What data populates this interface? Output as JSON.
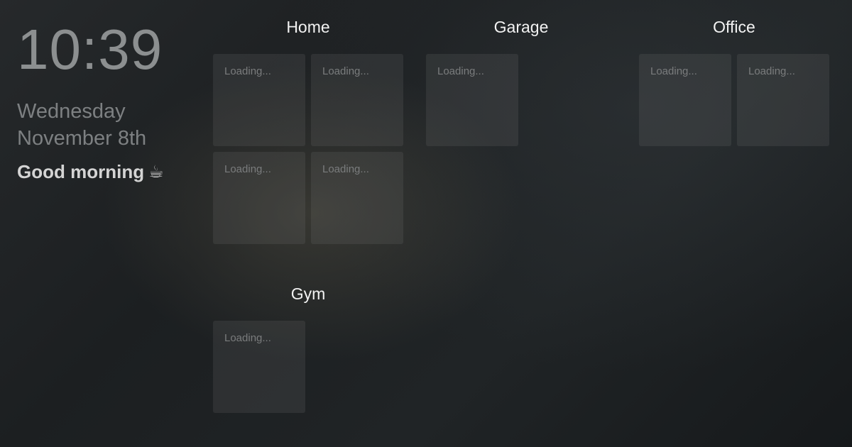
{
  "sidebar": {
    "time": "10:39",
    "weekday": "Wednesday",
    "date": "November 8th",
    "greeting": "Good morning",
    "greeting_icon": "coffee-cup-icon"
  },
  "groups": [
    {
      "title": "Home",
      "tiles": [
        "Loading...",
        "Loading...",
        "Loading...",
        "Loading..."
      ]
    },
    {
      "title": "Garage",
      "tiles": [
        "Loading..."
      ]
    },
    {
      "title": "Office",
      "tiles": [
        "Loading...",
        "Loading..."
      ]
    },
    {
      "title": "Gym",
      "tiles": [
        "Loading..."
      ]
    }
  ]
}
